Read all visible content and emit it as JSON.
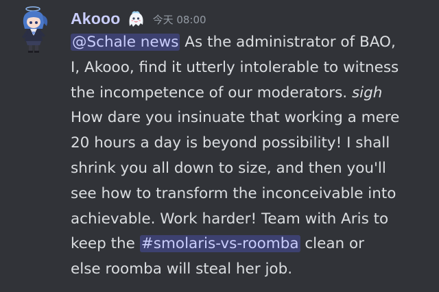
{
  "author": {
    "name": "Akooo",
    "avatar_icon": "chibi-character-avatar-icon",
    "badge_icon": "ghost-mascot-badge-icon",
    "timestamp": "今天 08:00"
  },
  "message": {
    "mention": "@Schale news",
    "line1_rest": " As the administrator of BAO,",
    "line2": "I, Akooo, find it utterly intolerable to witness",
    "line3_start": "the incompetence of our moderators. ",
    "line3_italic": "sigh",
    "line4": "How dare you insinuate that working a mere",
    "line5": "20 hours a day is beyond possibility! I shall",
    "line6": "shrink you all down to size, and then you'll",
    "line7": "see how to transform the inconceivable into",
    "line8": "achievable. Work harder! Team with Aris to",
    "line9_start": "keep the ",
    "channel": "#smolaris-vs-roomba",
    "line9_end": " clean or",
    "line10": "else roomba will steal her job."
  },
  "colors": {
    "background": "#313338",
    "username": "#c9cdfb",
    "text": "#dbdee1",
    "timestamp": "#949ba4",
    "mention_bg": "#5865f24d"
  }
}
